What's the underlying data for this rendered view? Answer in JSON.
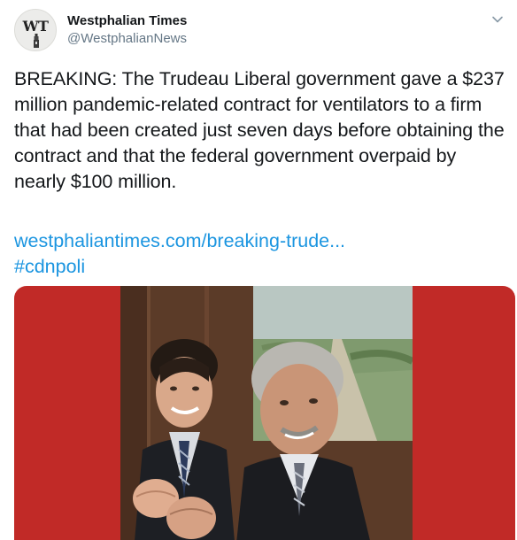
{
  "account": {
    "avatar_text": "WT",
    "display_name": "Westphalian Times",
    "handle": "@WestphalianNews"
  },
  "tweet": {
    "text": "BREAKING: The Trudeau Liberal government gave a $237 million pandemic-related contract for ventilators to a firm that had been created just seven days before obtaining the contract and that the federal government overpaid by nearly $100 million.",
    "link": "westphaliantimes.com/breaking-trude...",
    "hashtag": "#cdnpoli"
  },
  "icons": {
    "menu": "chevron-down-icon",
    "avatar_emblem": "tower-icon"
  },
  "colors": {
    "link": "#1b95e0",
    "media_background": "#c12a27",
    "text": "#14171a",
    "secondary_text": "#657786"
  }
}
